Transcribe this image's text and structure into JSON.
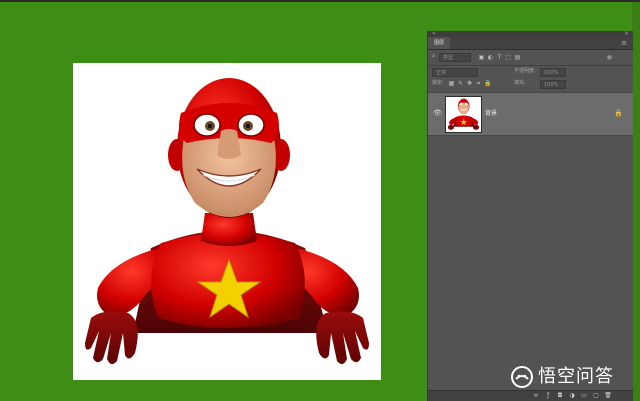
{
  "panel": {
    "tab_label": "图层",
    "collapse_glyph": "«",
    "close_glyph": "×",
    "menu_glyph": "≡",
    "filter": {
      "kind_value": "类型",
      "kind_icon": "search-icon"
    },
    "blend_mode": "正常",
    "opacity_label": "不透明度:",
    "opacity_value": "100%",
    "lock_label": "锁定:",
    "fill_label": "填充:",
    "fill_value": "100%",
    "layers": [
      {
        "name": "背景",
        "visible": true,
        "locked": true
      }
    ],
    "footer_icons": [
      "link-icon",
      "fx-icon",
      "mask-icon",
      "adjustment-icon",
      "group-icon",
      "new-layer-icon",
      "trash-icon"
    ]
  },
  "watermark": {
    "text": "悟空问答"
  },
  "colors": {
    "background_green": "#3e8e16",
    "panel_bg": "#535353",
    "selected_layer": "#6c6c6c",
    "hero_red": "#d10000",
    "star_yellow": "#f3d000"
  }
}
